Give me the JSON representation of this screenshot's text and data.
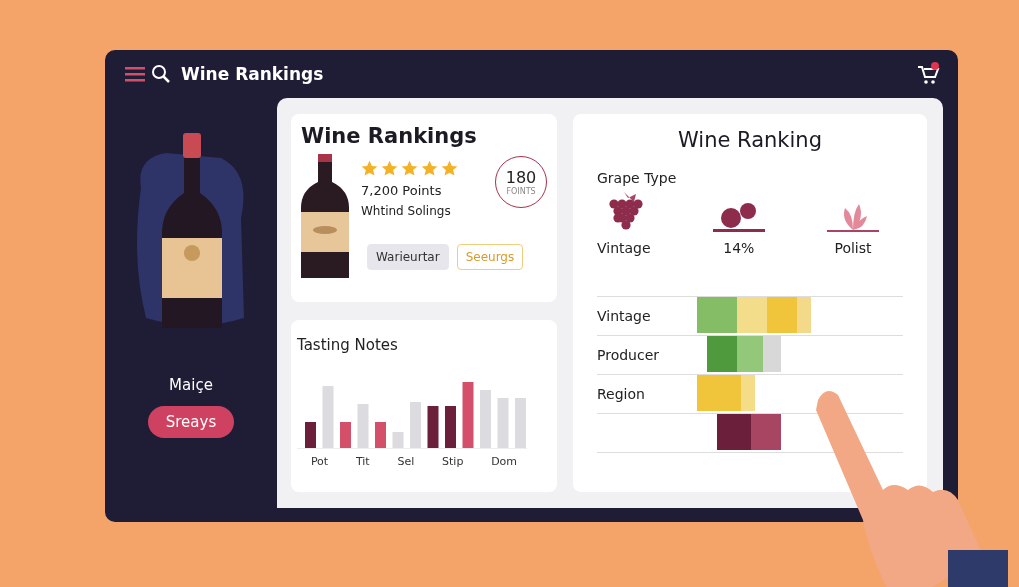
{
  "header": {
    "title": "Wine Rankings"
  },
  "sidebar": {
    "name": "Maiçe",
    "button": "Sreays"
  },
  "summary_card": {
    "title": "Wine Rankings",
    "stars": 5,
    "points": "7,200 Points",
    "subtitle": "Whtind Solings",
    "score": "180",
    "score_unit": "FOINTS",
    "buttons": [
      {
        "label": "Warieurtar",
        "kind": "plain"
      },
      {
        "label": "Seeurgs",
        "kind": "outline"
      }
    ]
  },
  "tasting_notes": {
    "title": "Tasting Notes",
    "labels": [
      "Pot",
      "Tit",
      "Sel",
      "Stip",
      "Dom"
    ]
  },
  "ranking_card": {
    "title": "Wine Ranking",
    "section_title": "Grape Type",
    "attributes": [
      {
        "label": "Vintage",
        "kind": "grapes"
      },
      {
        "label": "14%",
        "kind": "fruit"
      },
      {
        "label": "Polist",
        "kind": "plant"
      }
    ],
    "rows": [
      "Vintage",
      "Producer",
      "Region"
    ]
  }
}
